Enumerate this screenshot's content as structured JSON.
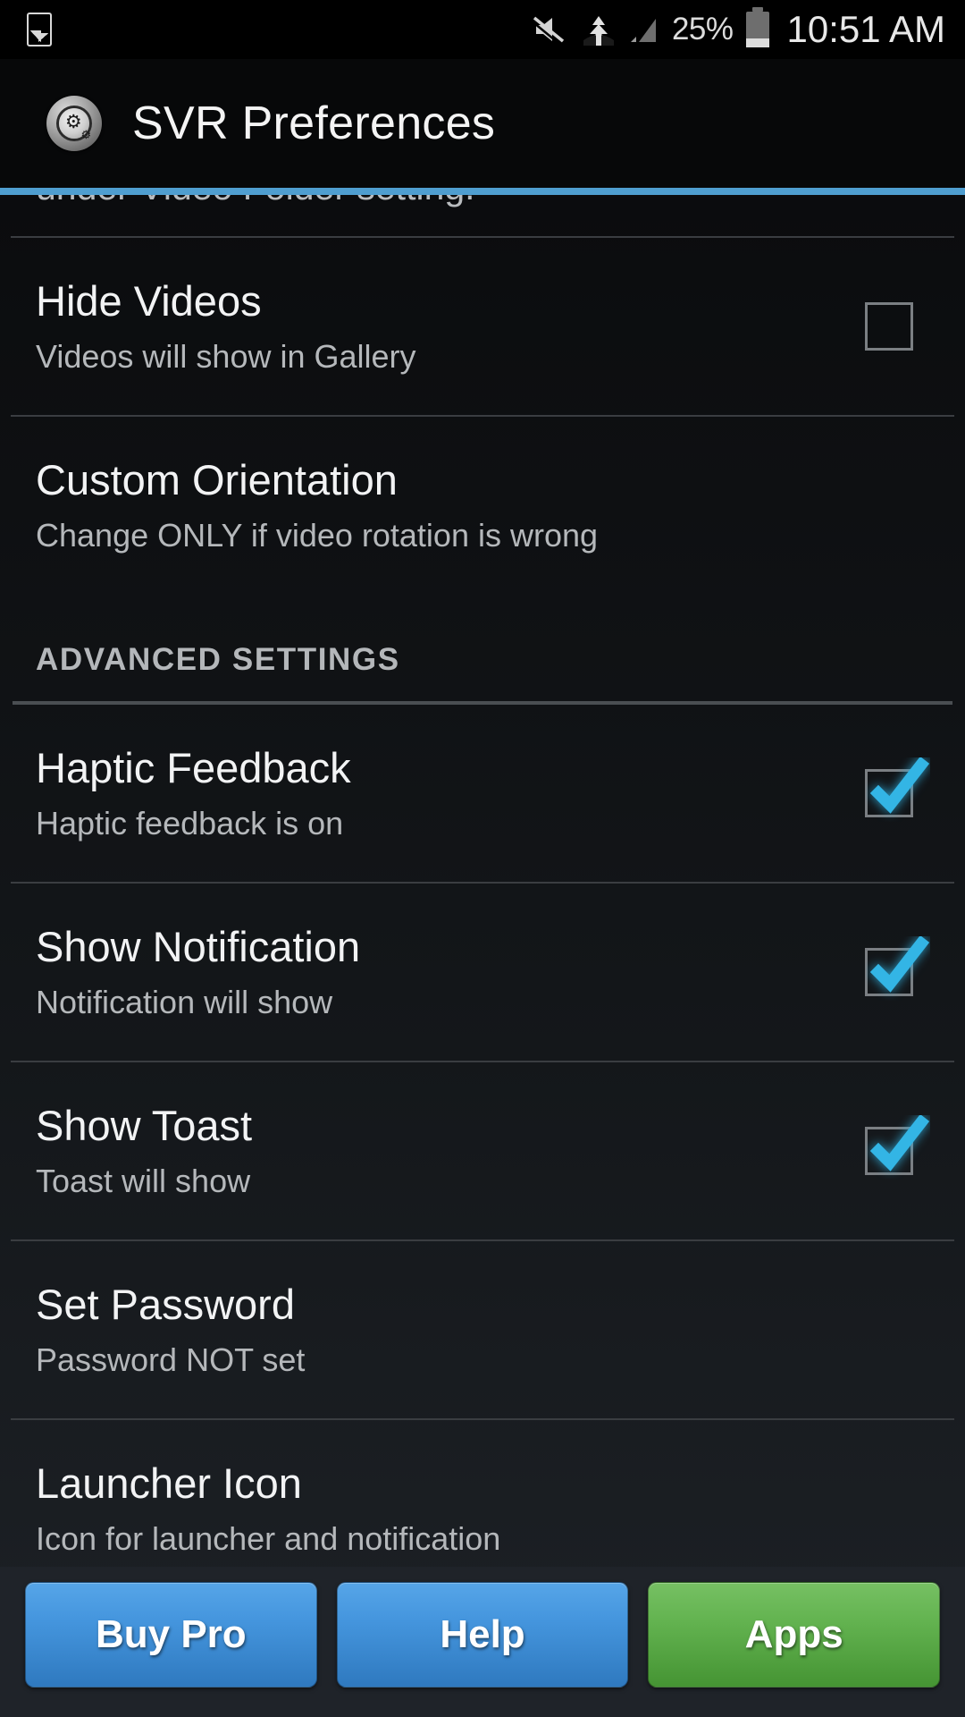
{
  "statusbar": {
    "left_icons": [
      "photo-icon"
    ],
    "right_icons": [
      "mute-icon",
      "vpn-tree-icon",
      "signal-icon",
      "battery-icon"
    ],
    "battery_percent": "25%",
    "clock": "10:51 AM"
  },
  "appbar": {
    "icon": "svr-disc-gear-icon",
    "title": "SVR Preferences",
    "accent_color": "#4f9ed0"
  },
  "list": {
    "clipped_top_text": "under Video Folder setting.",
    "rows": [
      {
        "name": "hide-videos",
        "title": "Hide Videos",
        "subtitle": "Videos will show in Gallery",
        "control": "checkbox",
        "checked": false
      },
      {
        "name": "custom-orientation",
        "title": "Custom Orientation",
        "subtitle": "Change ONLY if video rotation is wrong",
        "control": "none",
        "checked": null
      }
    ],
    "section": {
      "name": "advanced-settings",
      "label": "ADVANCED SETTINGS",
      "rows": [
        {
          "name": "haptic-feedback",
          "title": "Haptic Feedback",
          "subtitle": "Haptic feedback is on",
          "control": "checkbox",
          "checked": true
        },
        {
          "name": "show-notification",
          "title": "Show Notification",
          "subtitle": "Notification will show",
          "control": "checkbox",
          "checked": true
        },
        {
          "name": "show-toast",
          "title": "Show Toast",
          "subtitle": "Toast will show",
          "control": "checkbox",
          "checked": true
        },
        {
          "name": "set-password",
          "title": "Set Password",
          "subtitle": "Password NOT set",
          "control": "none",
          "checked": null
        },
        {
          "name": "launcher-icon",
          "title": "Launcher Icon",
          "subtitle": "Icon for launcher and notification",
          "control": "none",
          "checked": null
        }
      ]
    }
  },
  "buttons": [
    {
      "name": "buy-pro-button",
      "label": "Buy Pro",
      "color": "#4596de"
    },
    {
      "name": "help-button",
      "label": "Help",
      "color": "#4596de"
    },
    {
      "name": "apps-button",
      "label": "Apps",
      "color": "#64b451"
    }
  ],
  "colors": {
    "checkbox_check": "#33b5e5",
    "accent": "#4f9ed0",
    "title_text": "#f2f3f4",
    "subtitle_text": "#b5b8bb"
  }
}
